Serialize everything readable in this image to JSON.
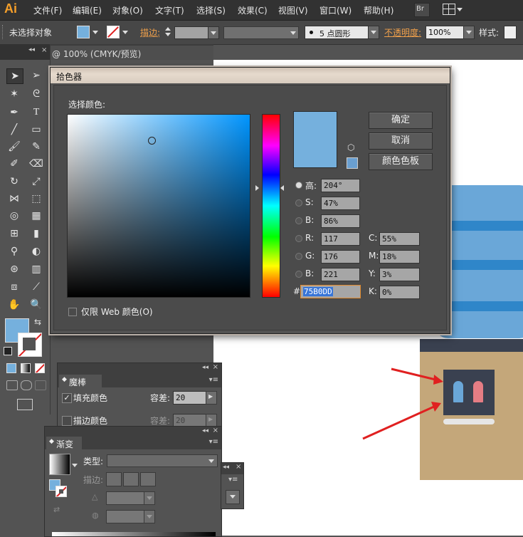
{
  "menubar": {
    "logo": "Ai",
    "items": [
      "文件(F)",
      "编辑(E)",
      "对象(O)",
      "文字(T)",
      "选择(S)",
      "效果(C)",
      "视图(V)",
      "窗口(W)",
      "帮助(H)"
    ],
    "bridge": "Br"
  },
  "control": {
    "selection": "未选择对象",
    "stroke_label": "描边:",
    "brush": "5 点圆形",
    "opacity_label": "不透明度:",
    "opacity_value": "100%",
    "style_label": "样式:"
  },
  "document": {
    "tab_title": "@ 100% (CMYK/预览)"
  },
  "color_picker": {
    "title": "拾色器",
    "select_color_label": "选择颜色:",
    "ok": "确定",
    "cancel": "取消",
    "swatches": "颜色色板",
    "web_only": "仅限 Web 颜色(O)",
    "current_color": "#75B0DD",
    "fields": {
      "H_label": "高:",
      "H": "204°",
      "S_label": "S:",
      "S": "47%",
      "Bv_label": "B:",
      "Bv": "86%",
      "R_label": "R:",
      "R": "117",
      "G_label": "G:",
      "G": "176",
      "Bc_label": "B:",
      "Bc": "221",
      "C_label": "C:",
      "C": "55%",
      "M_label": "M:",
      "M": "18%",
      "Y_label": "Y:",
      "Y": "3%",
      "K_label": "K:",
      "K": "0%",
      "hex_label": "#",
      "hex": "75B0DD"
    }
  },
  "magic_wand": {
    "title": "魔棒",
    "fill_label": "填充颜色",
    "fill_checked": true,
    "tolerance_label": "容差:",
    "fill_tolerance": "20",
    "stroke_label": "描边颜色",
    "stroke_tolerance": "20"
  },
  "gradient": {
    "title": "渐变",
    "type_label": "类型:",
    "stroke_label": "描边:"
  },
  "colors": {
    "fill": "#75B0DD",
    "light_blue_shape": "#6aa7d8",
    "stripe": "#2f86c9",
    "tan": "#c4a77a",
    "dark_panel": "#3a4150",
    "pin_blue": "#6aa7d8",
    "pin_pink": "#e57d84",
    "arrow": "#e02020"
  }
}
